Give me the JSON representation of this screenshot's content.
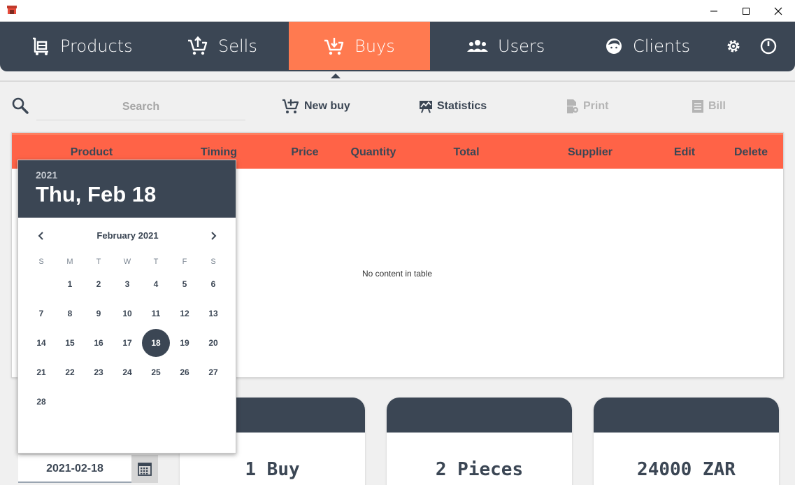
{
  "nav": {
    "products": "Products",
    "sells": "Sells",
    "buys": "Buys",
    "users": "Users",
    "clients": "Clients",
    "active": "buys"
  },
  "toolbar": {
    "search_placeholder": "Search",
    "new_buy": "New buy",
    "statistics": "Statistics",
    "print": "Print",
    "bill": "Bill"
  },
  "table": {
    "columns": [
      "Product",
      "Timing",
      "Price",
      "Quantity",
      "Total",
      "Supplier",
      "Edit",
      "Delete"
    ],
    "empty_message": "No content in table"
  },
  "cards": [
    {
      "value": "1 Buy"
    },
    {
      "value": "2 Pieces"
    },
    {
      "value": "24000 ZAR"
    }
  ],
  "date_field": {
    "value": "2021-02-18"
  },
  "date_picker": {
    "year": "2021",
    "selected_label": "Thu, Feb 18",
    "month_label": "February 2021",
    "weekdays": [
      "S",
      "M",
      "T",
      "W",
      "T",
      "F",
      "S"
    ],
    "first_weekday_index": 1,
    "days_in_month": 28,
    "selected_day": 18
  },
  "colors": {
    "primary": "#3b4654",
    "accent": "#ff7a50",
    "table_header": "#ff6347"
  },
  "icons": {
    "search": "search-icon",
    "new_buy": "cart-plus-icon",
    "statistics": "chart-icon",
    "print": "print-icon",
    "bill": "bill-icon",
    "date": "calendar-icon"
  }
}
